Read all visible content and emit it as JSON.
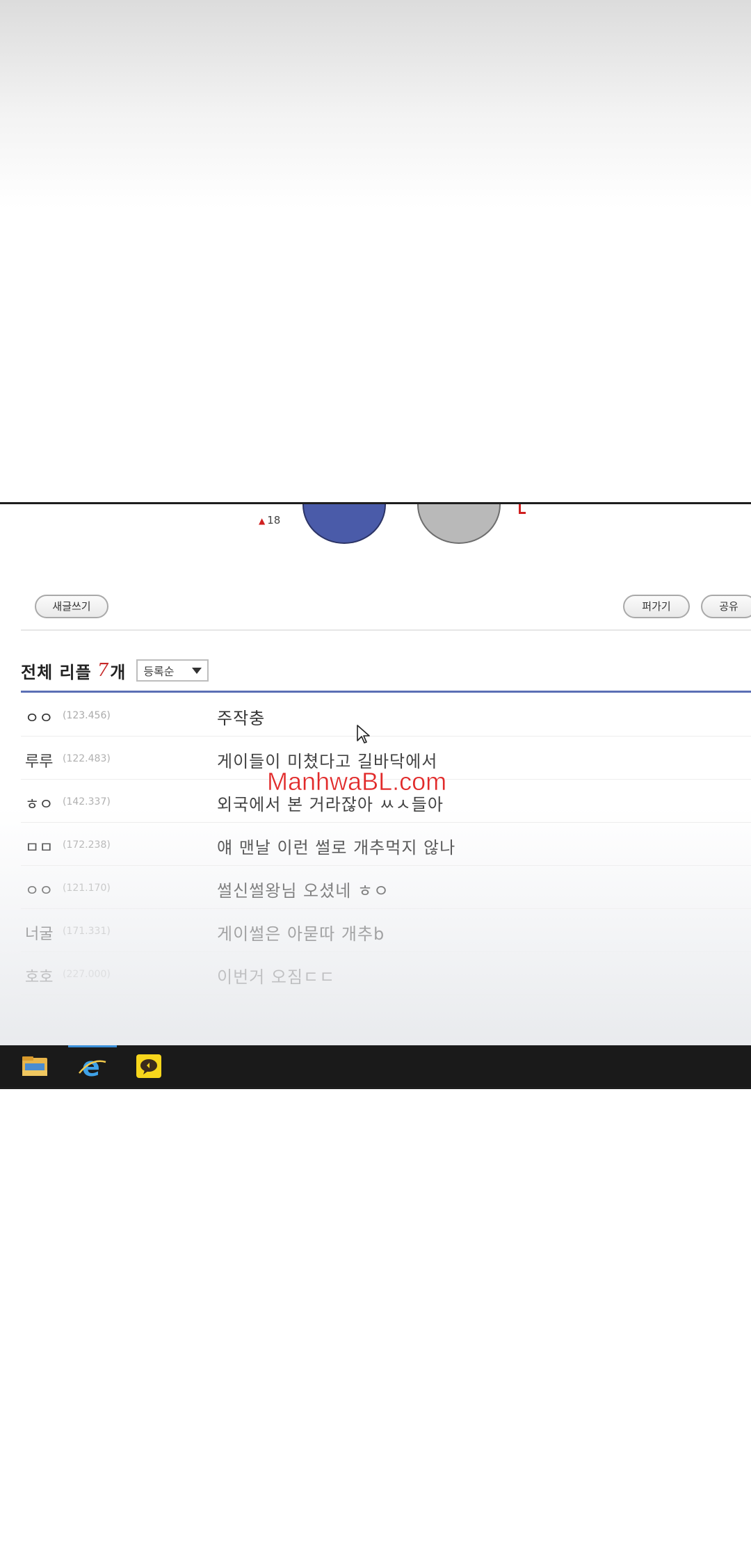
{
  "poll": {
    "vote_count": "18"
  },
  "toolbar": {
    "write_label": "새글쓰기",
    "scrap_label": "퍼가기",
    "share_label": "공유"
  },
  "comments_header": {
    "label": "전체 리플",
    "count": "7",
    "unit": "개",
    "sort_selected": "등록순"
  },
  "comments": [
    {
      "nick": "ㅇㅇ",
      "ip": "(123.456)",
      "text": "주작충"
    },
    {
      "nick": "루루",
      "ip": "(122.483)",
      "text": "게이들이 미쳤다고 길바닥에서"
    },
    {
      "nick": "ㅎㅇ",
      "ip": "(142.337)",
      "text": "외국에서 본 거라잖아 ㅆㅅ들아"
    },
    {
      "nick": "ㅁㅁ",
      "ip": "(172.238)",
      "text": "얘 맨날 이런 썰로 개추먹지 않나"
    },
    {
      "nick": "ㅇㅇ",
      "ip": "(121.170)",
      "text": "썰신썰왕님 오셨네 ㅎㅇ"
    },
    {
      "nick": "너굴",
      "ip": "(171.331)",
      "text": "게이썰은 아묻따 개추b"
    },
    {
      "nick": "호호",
      "ip": "(227.000)",
      "text": "이번거 오짐ㄷㄷ"
    }
  ],
  "watermark": "ManhwaBL.com",
  "colors": {
    "accent_blue": "#5b6fb5",
    "poll_blue": "#4a5ba9",
    "poll_gray": "#b9b9b9",
    "count_red": "#c62828",
    "watermark_red": "#e12a2a"
  }
}
